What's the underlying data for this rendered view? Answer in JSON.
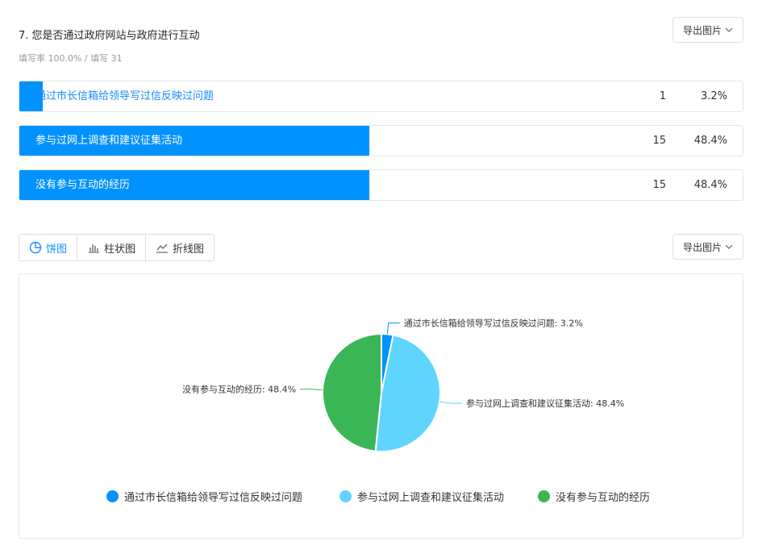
{
  "question": {
    "title": "7. 您是否通过政府网站与政府进行互动",
    "meta": "填写率 100.0% / 填写 31"
  },
  "export_label": "导出图片",
  "options": [
    {
      "label": "通过市长信箱给领导写过信反映过问题",
      "count": "1",
      "percent": "3.2%",
      "fraction": 0.032
    },
    {
      "label": "参与过网上调查和建议征集活动",
      "count": "15",
      "percent": "48.4%",
      "fraction": 0.484
    },
    {
      "label": "没有参与互动的经历",
      "count": "15",
      "percent": "48.4%",
      "fraction": 0.484
    }
  ],
  "tabs": [
    {
      "label": "饼图",
      "icon": "pie-chart-icon",
      "active": true
    },
    {
      "label": "柱状图",
      "icon": "bar-chart-icon",
      "active": false
    },
    {
      "label": "折线图",
      "icon": "line-chart-icon",
      "active": false
    }
  ],
  "chart_data": {
    "type": "pie",
    "categories": [
      "通过市长信箱给领导写过信反映过问题",
      "参与过网上调查和建议征集活动",
      "没有参与互动的经历"
    ],
    "values": [
      3.2,
      48.4,
      48.4
    ],
    "slice_labels": [
      "通过市长信箱给领导写过信反映过问题: 3.2%",
      "参与过网上调查和建议征集活动: 48.4%",
      "没有参与互动的经历: 48.4%"
    ],
    "colors": [
      "#0092ff",
      "#5fd4ff",
      "#3ab656"
    ],
    "legend_position": "bottom"
  }
}
